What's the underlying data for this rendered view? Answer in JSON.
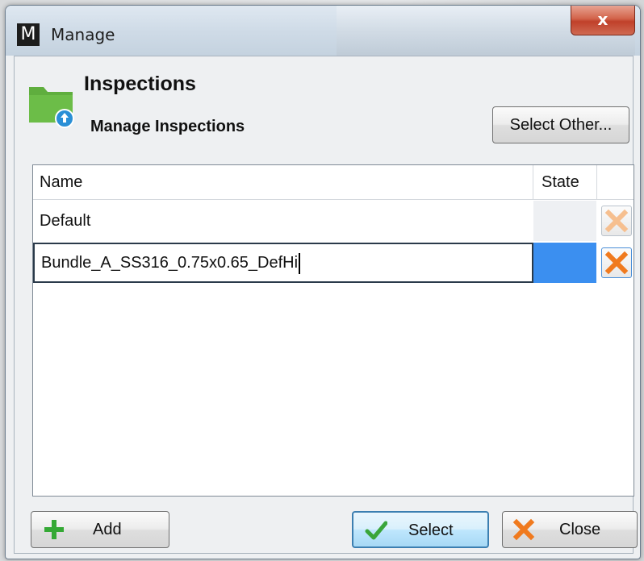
{
  "window": {
    "app_logo_letter": "M",
    "title": "Manage",
    "close_glyph": "x"
  },
  "header": {
    "title": "Inspections",
    "subtitle": "Manage Inspections",
    "icon": "folder-upload-icon",
    "select_other_label": "Select Other..."
  },
  "grid": {
    "columns": [
      "Name",
      "State",
      ""
    ],
    "rows": [
      {
        "name": "Default",
        "state": "",
        "editing": false
      },
      {
        "name": "Bundle_A_SS316_0.75x0.65_DefHi",
        "state": "",
        "editing": true
      }
    ]
  },
  "footer": {
    "add_label": "Add",
    "select_label": "Select",
    "close_label": "Close"
  },
  "colors": {
    "folder_green": "#5fae3e",
    "upload_blue": "#2a8fd6",
    "state_selected": "#3b8ff0",
    "delete_orange": "#f07a1e",
    "delete_orange_faded": "#f6bf8f",
    "add_green": "#35a935",
    "select_check_green": "#3aa53a"
  }
}
